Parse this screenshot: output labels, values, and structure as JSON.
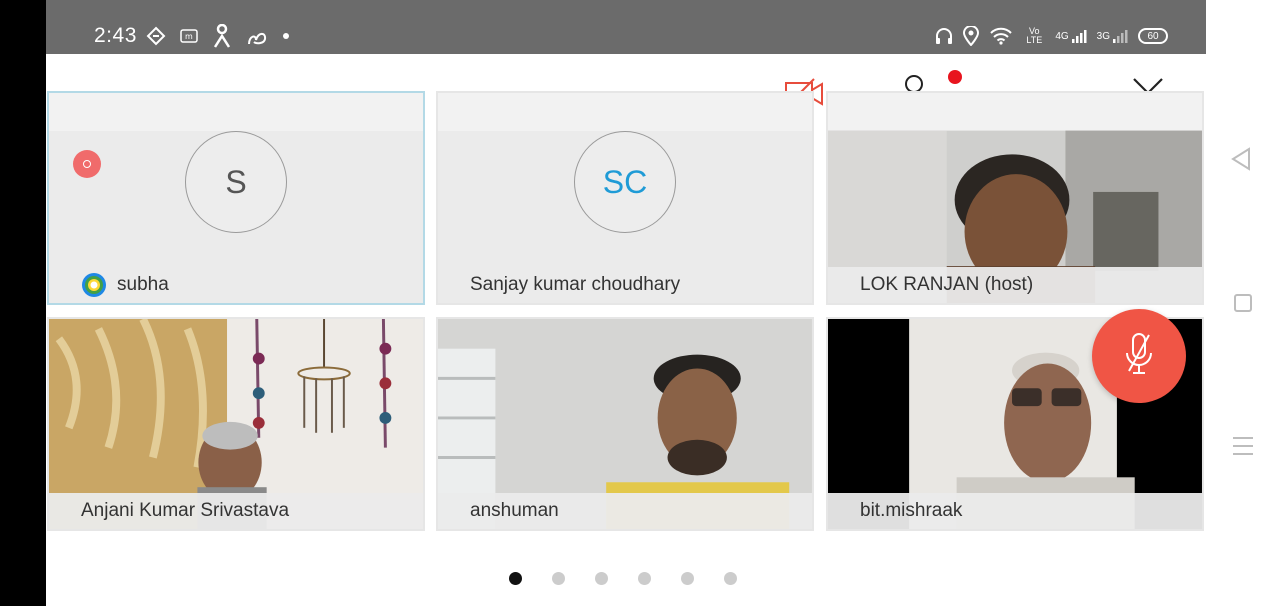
{
  "status_bar": {
    "time": "2:43",
    "network_label": "4G",
    "network_label_2": "3G",
    "volte_label": "Vo LTE",
    "battery": "60"
  },
  "toolbar": {
    "icons": [
      "video-off-icon",
      "participants-icon",
      "more-icon",
      "close-icon"
    ],
    "accent_color": "#e74c3c"
  },
  "participants": [
    {
      "name": "subha",
      "initials": "S",
      "has_video": false,
      "initials_color": "#555555",
      "active": true
    },
    {
      "name": "Sanjay kumar choudhary",
      "initials": "SC",
      "has_video": false,
      "initials_color": "#1f9bd6",
      "active": false
    },
    {
      "name": "LOK RANJAN (host)",
      "has_video": true,
      "active": false
    },
    {
      "name": "Anjani Kumar Srivastava",
      "has_video": true,
      "active": false
    },
    {
      "name": "anshuman",
      "has_video": true,
      "active": false
    },
    {
      "name": "bit.mishraak",
      "has_video": true,
      "active": false
    }
  ],
  "pagination": {
    "total_pages": 6,
    "current_page": 1
  },
  "mic_button_color": "#f05545"
}
